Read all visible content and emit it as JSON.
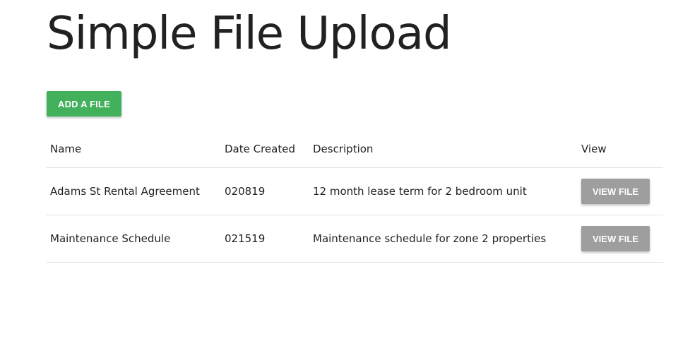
{
  "page": {
    "title": "Simple File Upload"
  },
  "actions": {
    "add_file_label": "ADD A FILE"
  },
  "table": {
    "headers": {
      "name": "Name",
      "date_created": "Date Created",
      "description": "Description",
      "view": "View"
    },
    "rows": [
      {
        "name": "Adams St Rental Agreement",
        "date_created": "020819",
        "description": "12 month lease term for 2 bedroom unit",
        "view_label": "VIEW FILE"
      },
      {
        "name": "Maintenance Schedule",
        "date_created": "021519",
        "description": "Maintenance schedule for zone 2 properties",
        "view_label": "VIEW FILE"
      }
    ]
  },
  "colors": {
    "add_button": "#43b05c",
    "view_button": "#9e9e9e",
    "divider": "#e2e2e2"
  }
}
